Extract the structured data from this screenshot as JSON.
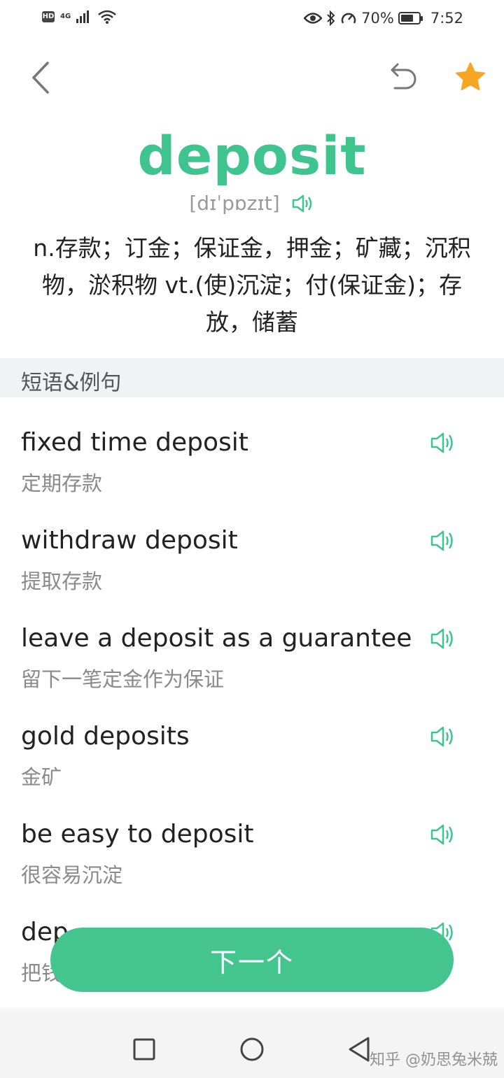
{
  "status_bar": {
    "hd_label": "HD",
    "network_label": "4G",
    "battery_percent": "70%",
    "battery_level": 0.7,
    "time": "7:52"
  },
  "nav": {
    "back_icon": "chevron-left-icon",
    "undo_icon": "undo-icon",
    "star_icon": "star-icon",
    "star_color": "#f6a623"
  },
  "entry": {
    "word": "deposit",
    "phonetic": "[dɪˈpɒzɪt]",
    "definition": "n.存款；订金；保证金，押金；矿藏；沉积物，淤积物 vt.(使)沉淀；付(保证金)；存放，储蓄",
    "accent_color": "#3fc48f"
  },
  "section": {
    "title": "短语&例句"
  },
  "phrases": [
    {
      "en": "fixed time deposit",
      "zh": "定期存款"
    },
    {
      "en": "withdraw deposit",
      "zh": "提取存款"
    },
    {
      "en": "leave a deposit as a guarantee",
      "zh": "留下一笔定金作为保证"
    },
    {
      "en": "gold deposits",
      "zh": "金矿"
    },
    {
      "en": "be easy to deposit",
      "zh": "很容易沉淀"
    },
    {
      "en": "dep",
      "zh": "把钱"
    }
  ],
  "next_button": {
    "label": "下一个"
  },
  "watermark": "知乎 @奶思兔米兢"
}
